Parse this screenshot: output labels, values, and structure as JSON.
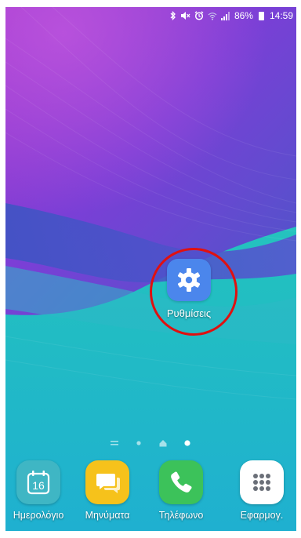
{
  "status_bar": {
    "battery": "86%",
    "time": "14:59",
    "icons": [
      "bluetooth-icon",
      "mute-icon",
      "alarm-icon",
      "wifi-icon",
      "signal-icon",
      "battery-icon"
    ]
  },
  "home": {
    "settings_app": {
      "label": "Ρυθμίσεις",
      "icon": "gear-icon",
      "color": "#4b86ec",
      "highlighted": true,
      "highlight_color": "#e01010"
    },
    "page_indicator": {
      "items": [
        "menu-lines-icon",
        "page-dot",
        "home-icon",
        "page-dot"
      ],
      "active_index": 3
    }
  },
  "dock": {
    "apps": [
      {
        "label": "Ημερολόγιο",
        "icon": "calendar-icon",
        "value": "16",
        "color": "#3fb6c4"
      },
      {
        "label": "Μηνύματα",
        "icon": "messages-icon",
        "color": "#f6c21b"
      },
      {
        "label": "Τηλέφωνο",
        "icon": "phone-icon",
        "color": "#3cc25a"
      },
      {
        "label": "Εφαρμογ.",
        "icon": "apps-grid-icon",
        "color": "#ffffff"
      }
    ]
  }
}
